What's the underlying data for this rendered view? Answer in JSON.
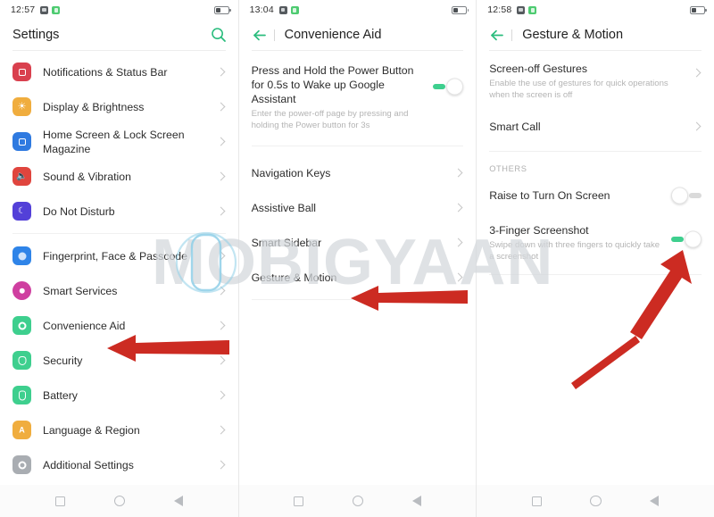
{
  "panels": [
    {
      "status": {
        "time": "12:57",
        "icons": [
          "screenshot-icon",
          "app-green-icon"
        ],
        "battery": "battery-low-icon"
      },
      "header": {
        "title": "Settings",
        "search_icon": "search-icon"
      },
      "items": [
        {
          "label": "Notifications & Status Bar",
          "icon": "notifications-icon",
          "color": "#d9404e",
          "glyph": "square",
          "chevron": true
        },
        {
          "label": "Display & Brightness",
          "icon": "brightness-icon",
          "color": "#f0ad3e",
          "glyph": "sun",
          "chevron": true
        },
        {
          "label": "Home Screen & Lock Screen Magazine",
          "icon": "home-screen-icon",
          "color": "#2f7ae0",
          "glyph": "image",
          "chevron": true
        },
        {
          "label": "Sound & Vibration",
          "icon": "sound-icon",
          "color": "#e0453e",
          "glyph": "speaker",
          "chevron": true
        },
        {
          "label": "Do Not Disturb",
          "icon": "do-not-disturb-icon",
          "color": "#5340d8",
          "glyph": "moon",
          "chevron": true,
          "separator_after": true
        },
        {
          "label": "Fingerprint, Face & Passcode",
          "icon": "fingerprint-face-icon",
          "color": "#2f84e8",
          "glyph": "face",
          "chevron": true
        },
        {
          "label": "Smart Services",
          "icon": "smart-services-icon",
          "color": "#cf3fa0",
          "glyph": "ring",
          "chevron": true
        },
        {
          "label": "Convenience Aid",
          "icon": "convenience-aid-icon",
          "color": "#3ecf8e",
          "glyph": "bulb",
          "chevron": true
        },
        {
          "label": "Security",
          "icon": "security-icon",
          "color": "#3ecf8e",
          "glyph": "shield",
          "chevron": true
        },
        {
          "label": "Battery",
          "icon": "battery-settings-icon",
          "color": "#3ecf8e",
          "glyph": "battery",
          "chevron": true
        },
        {
          "label": "Language & Region",
          "icon": "language-icon",
          "color": "#f0ad3e",
          "glyph": "letterA",
          "chevron": true
        },
        {
          "label": "Additional Settings",
          "icon": "additional-settings-icon",
          "color": "#a9adb2",
          "glyph": "gear",
          "chevron": true
        }
      ]
    },
    {
      "status": {
        "time": "13:04",
        "icons": [
          "screenshot-icon",
          "app-green-icon"
        ],
        "battery": "battery-low-icon"
      },
      "header": {
        "title": "Convenience Aid",
        "back_icon": "back-arrow-icon"
      },
      "items": [
        {
          "label": "Press and Hold the Power Button for 0.5s to Wake up Google Assistant",
          "sub": "Enter the power-off page by pressing and holding the Power button for 3s",
          "toggle": "on",
          "separator_after": true
        },
        {
          "label": "Navigation Keys",
          "chevron": true
        },
        {
          "label": "Assistive Ball",
          "chevron": true
        },
        {
          "label": "Smart Sidebar",
          "chevron": true
        },
        {
          "label": "Gesture & Motion",
          "chevron": true,
          "separator_after": true
        }
      ]
    },
    {
      "status": {
        "time": "12:58",
        "icons": [
          "screenshot-icon",
          "app-green-icon"
        ],
        "battery": "battery-low-icon"
      },
      "header": {
        "title": "Gesture & Motion",
        "back_icon": "back-arrow-icon"
      },
      "items": [
        {
          "label": "Screen-off Gestures",
          "sub": "Enable the use of gestures for quick operations when the screen is off",
          "chevron": true
        },
        {
          "label": "Smart Call",
          "chevron": true,
          "separator_after": true
        },
        {
          "group": "OTHERS"
        },
        {
          "label": "Raise to Turn On Screen",
          "toggle": "off"
        },
        {
          "label": "3-Finger Screenshot",
          "sub": "Swipe down with three fingers to quickly take a screenshot",
          "toggle": "on",
          "separator_after": true
        }
      ]
    }
  ],
  "navbar": {
    "recents": "recents-square-icon",
    "home": "home-circle-icon",
    "back": "back-triangle-icon"
  },
  "watermark": {
    "text": "MOBIGYAAN"
  },
  "annotations": {
    "arrow_color": "#cc2b22",
    "arrows": [
      {
        "name": "arrow-convenience-aid",
        "direction": "left"
      },
      {
        "name": "arrow-gesture-motion",
        "direction": "left"
      },
      {
        "name": "arrow-3finger-toggle",
        "direction": "up-right"
      }
    ]
  },
  "colors": {
    "accent_green": "#3ecf8e",
    "text_primary": "#2c2c2c",
    "text_secondary": "#b4b4b4"
  }
}
